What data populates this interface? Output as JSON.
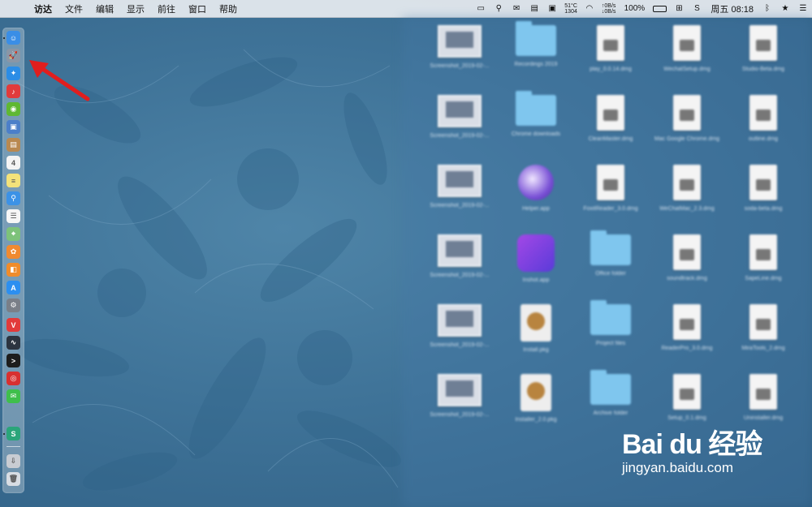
{
  "menubar": {
    "app_name": "访达",
    "items": [
      "文件",
      "编辑",
      "显示",
      "前往",
      "窗口",
      "帮助"
    ],
    "status": {
      "temp": "51°C",
      "rpm": "1304",
      "net_up": "↑0B/s",
      "net_down": "↓0B/s",
      "battery_percent": "100%",
      "battery_level": 1.0,
      "clock": "周五 08:18"
    }
  },
  "dock": {
    "icons": [
      {
        "name": "finder-icon",
        "color": "#3a8ee6",
        "glyph": "☺"
      },
      {
        "name": "launchpad-icon",
        "color": "#8a96a6",
        "glyph": "🚀"
      },
      {
        "name": "safari-icon",
        "color": "#2b8de6",
        "glyph": "✦"
      },
      {
        "name": "netease-music-icon",
        "color": "#e23b3b",
        "glyph": "♪"
      },
      {
        "name": "android-icon",
        "color": "#5fb832",
        "glyph": "◉"
      },
      {
        "name": "preview-icon",
        "color": "#4c7fc9",
        "glyph": "▣"
      },
      {
        "name": "notes-brown-icon",
        "color": "#b98950",
        "glyph": "▤"
      },
      {
        "name": "calendar-icon",
        "color": "#f4f4f4",
        "glyph": "4"
      },
      {
        "name": "notes-icon",
        "color": "#f3e27a",
        "glyph": "≡"
      },
      {
        "name": "finder-search-icon",
        "color": "#3c92e6",
        "glyph": "⚲"
      },
      {
        "name": "reminders-icon",
        "color": "#f6f6f6",
        "glyph": "☰"
      },
      {
        "name": "maps-icon",
        "color": "#7dc27a",
        "glyph": "⌖"
      },
      {
        "name": "photos-icon",
        "color": "#f08a30",
        "glyph": "✿"
      },
      {
        "name": "books-icon",
        "color": "#f08c2b",
        "glyph": "◧"
      },
      {
        "name": "app-store-icon",
        "color": "#2c8ff0",
        "glyph": "A"
      },
      {
        "name": "system-preferences-icon",
        "color": "#7a7f88",
        "glyph": "⚙"
      },
      {
        "name": "vivaldi-icon",
        "color": "#e23a3a",
        "glyph": "V"
      },
      {
        "name": "activity-monitor-icon",
        "color": "#2c3440",
        "glyph": "∿"
      },
      {
        "name": "terminal-icon",
        "color": "#1d1d1d",
        "glyph": ">"
      },
      {
        "name": "netease-cloud-icon",
        "color": "#d83030",
        "glyph": "◎"
      },
      {
        "name": "wechat-icon",
        "color": "#3fbf4c",
        "glyph": "✉"
      },
      {
        "name": "sogou-icon",
        "color": "#2aa57a",
        "glyph": "S"
      },
      {
        "name": "downloads-icon",
        "color": "#c8ccd2",
        "glyph": "⇩"
      },
      {
        "name": "trash-icon",
        "color": "#d8dde3",
        "glyph": "🗑"
      }
    ]
  },
  "desktop": {
    "items": [
      {
        "kind": "thumb",
        "caption": "Screenshot_2019-02-..."
      },
      {
        "kind": "folder",
        "caption": "Recordings 2019"
      },
      {
        "kind": "doc",
        "caption": "play_0.0.14.dmg"
      },
      {
        "kind": "doc",
        "caption": "WechatSetup.dmg"
      },
      {
        "kind": "doc",
        "caption": "Studio-Beta.dmg"
      },
      {
        "kind": "thumb",
        "caption": "Screenshot_2019-02-..."
      },
      {
        "kind": "folder",
        "caption": "Chrome downloads"
      },
      {
        "kind": "doc",
        "caption": "CleanMaster.dmg"
      },
      {
        "kind": "doc",
        "caption": "Mac Google Chrome.dmg"
      },
      {
        "kind": "doc",
        "caption": "outline.dmg"
      },
      {
        "kind": "thumb",
        "caption": "Screenshot_2019-02-..."
      },
      {
        "kind": "app-round",
        "caption": "Helper.app"
      },
      {
        "kind": "doc",
        "caption": "FoxitReader_3.0.dmg"
      },
      {
        "kind": "doc",
        "caption": "WeChatMac_2.3.dmg"
      },
      {
        "kind": "doc",
        "caption": "soda-beta.dmg"
      },
      {
        "kind": "thumb",
        "caption": "Screenshot_2019-02-..."
      },
      {
        "kind": "app-square",
        "caption": "Inshot.app"
      },
      {
        "kind": "folder",
        "caption": "Office folder"
      },
      {
        "kind": "doc",
        "caption": "soundtrack.dmg"
      },
      {
        "kind": "doc",
        "caption": "SapeLine.dmg"
      },
      {
        "kind": "thumb",
        "caption": "Screenshot_2019-02-..."
      },
      {
        "kind": "pkg",
        "caption": "Install.pkg"
      },
      {
        "kind": "folder",
        "caption": "Project files"
      },
      {
        "kind": "doc",
        "caption": "ReaderPro_3.0.dmg"
      },
      {
        "kind": "doc",
        "caption": "MiraTools_2.dmg"
      },
      {
        "kind": "thumb",
        "caption": "Screenshot_2019-02-..."
      },
      {
        "kind": "pkg",
        "caption": "Installer_2.0.pkg"
      },
      {
        "kind": "folder",
        "caption": "Archive folder"
      },
      {
        "kind": "doc",
        "caption": "Setup_0.1.dmg"
      },
      {
        "kind": "doc",
        "caption": "Uninstaller.dmg"
      }
    ]
  },
  "watermark": {
    "logo": "Bai du 经验",
    "url": "jingyan.baidu.com"
  },
  "colors": {
    "arrow": "#e01e1e",
    "wallpaper": "#3f7398"
  }
}
